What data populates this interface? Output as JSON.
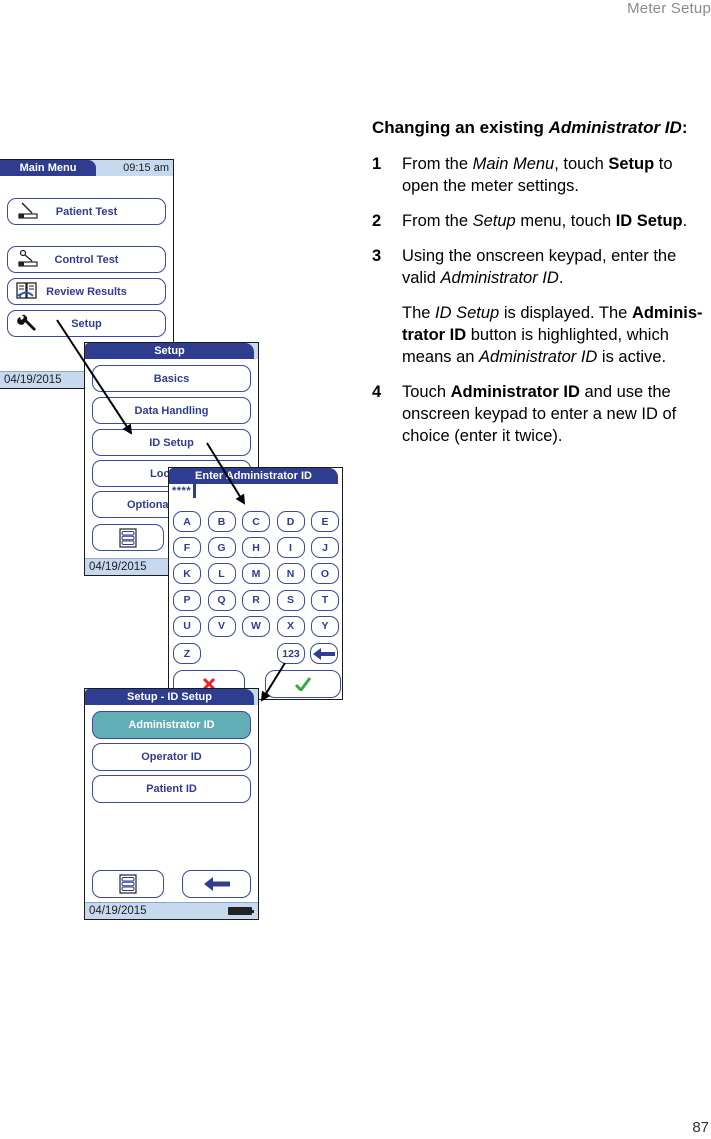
{
  "page": {
    "running_header": "Meter Setup",
    "page_number": "87"
  },
  "instructions": {
    "title_prefix": "Changing an existing ",
    "title_italic": "Administrator ID",
    "title_suffix": ":",
    "steps": [
      {
        "num": "1",
        "parts": [
          {
            "t": "From the ",
            "s": ""
          },
          {
            "t": "Main Menu",
            "s": "i"
          },
          {
            "t": ", touch ",
            "s": ""
          },
          {
            "t": "Setup",
            "s": "b"
          },
          {
            "t": " to open the meter settings.",
            "s": ""
          }
        ]
      },
      {
        "num": "2",
        "parts": [
          {
            "t": "From the ",
            "s": ""
          },
          {
            "t": "Setup",
            "s": "i"
          },
          {
            "t": " menu, touch ",
            "s": ""
          },
          {
            "t": "ID Setup",
            "s": "b"
          },
          {
            "t": ".",
            "s": ""
          }
        ]
      },
      {
        "num": "3",
        "parts": [
          {
            "t": "Using the onscreen keypad, enter the valid ",
            "s": ""
          },
          {
            "t": "Administrator ID",
            "s": "i"
          },
          {
            "t": ".",
            "s": ""
          }
        ]
      },
      {
        "num": "",
        "parts": [
          {
            "t": "The ",
            "s": ""
          },
          {
            "t": "ID Setup",
            "s": "i"
          },
          {
            "t": " is displayed. The ",
            "s": ""
          },
          {
            "t": "Adminis-trator ID",
            "s": "b"
          },
          {
            "t": " button is highlighted, which means an ",
            "s": ""
          },
          {
            "t": "Administrator ID",
            "s": "i"
          },
          {
            "t": " is active.",
            "s": ""
          }
        ]
      },
      {
        "num": "4",
        "parts": [
          {
            "t": "Touch ",
            "s": ""
          },
          {
            "t": "Administrator ID",
            "s": "b"
          },
          {
            "t": " and use the onscreen keypad to enter a new ID of choice (enter it twice).",
            "s": ""
          }
        ]
      }
    ]
  },
  "main_menu_screen": {
    "title": "Main Menu",
    "time": "09:15 am",
    "buttons": [
      {
        "label": "Patient Test",
        "icon": "patient-test-icon"
      },
      {
        "label": "Control Test",
        "icon": "control-test-icon"
      },
      {
        "label": "Review Results",
        "icon": "review-results-icon"
      },
      {
        "label": "Setup",
        "icon": "wrench-icon"
      }
    ],
    "date": "04/19/2015"
  },
  "setup_screen": {
    "title": "Setup",
    "buttons": [
      "Basics",
      "Data Handling",
      "ID Setup",
      "Lockouts",
      "Optional Screens"
    ],
    "visible_buttons": [
      "Basics",
      "Data Handling",
      "ID Setup",
      "Loc",
      "Optional"
    ],
    "date": "04/19/2015"
  },
  "keypad_screen": {
    "title": "Enter Administrator ID",
    "entry": "****",
    "keys": [
      [
        "A",
        "B",
        "C",
        "D",
        "E"
      ],
      [
        "F",
        "G",
        "H",
        "I",
        "J"
      ],
      [
        "K",
        "L",
        "M",
        "N",
        "O"
      ],
      [
        "P",
        "Q",
        "R",
        "S",
        "T"
      ],
      [
        "U",
        "V",
        "W",
        "X",
        "Y"
      ]
    ],
    "last_row": {
      "z": "Z",
      "num": "123"
    },
    "cancel_icon": "x-icon",
    "confirm_icon": "check-icon",
    "colors": {
      "cancel": "#e8232a",
      "confirm": "#3aa845"
    }
  },
  "id_setup_screen": {
    "title": "Setup - ID Setup",
    "buttons": [
      {
        "label": "Administrator ID",
        "highlighted": true
      },
      {
        "label": "Operator ID",
        "highlighted": false
      },
      {
        "label": "Patient ID",
        "highlighted": false
      }
    ],
    "date": "04/19/2015",
    "highlight_color": "#62aeb6"
  },
  "colors": {
    "brand_dark_blue": "#2e3d8f",
    "bar_light_blue": "#c6d9ee"
  }
}
